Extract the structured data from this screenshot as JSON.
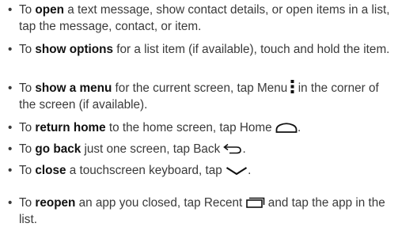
{
  "items": [
    {
      "pre": "To ",
      "kw": "open",
      "post": " a text message, show contact details, or open items in a list, tap the message, contact, or item."
    },
    {
      "pre": "To ",
      "kw": "show options",
      "post": " for a list item (if available), touch and hold the item."
    },
    {
      "pre": "To ",
      "kw": "show a menu",
      "mid": " for the current screen, tap Menu",
      "post": " in the corner of the screen (if available).",
      "icon": "menu-dots-icon"
    },
    {
      "pre": "To ",
      "kw": "return home",
      "mid": " to the home screen, tap Home",
      "post": ".",
      "icon": "home-icon"
    },
    {
      "pre": "To ",
      "kw": "go back",
      "mid": " just one screen, tap Back",
      "post": ".",
      "icon": "back-arrow-icon"
    },
    {
      "pre": "To ",
      "kw": "close",
      "mid": " a touchscreen keyboard, tap",
      "post": ".",
      "icon": "chevron-down-icon"
    },
    {
      "pre": "To ",
      "kw": "reopen",
      "mid": " an app you closed, tap Recent",
      "post": " and tap the app in the list.",
      "icon": "recent-apps-icon"
    }
  ],
  "bullet": "•"
}
